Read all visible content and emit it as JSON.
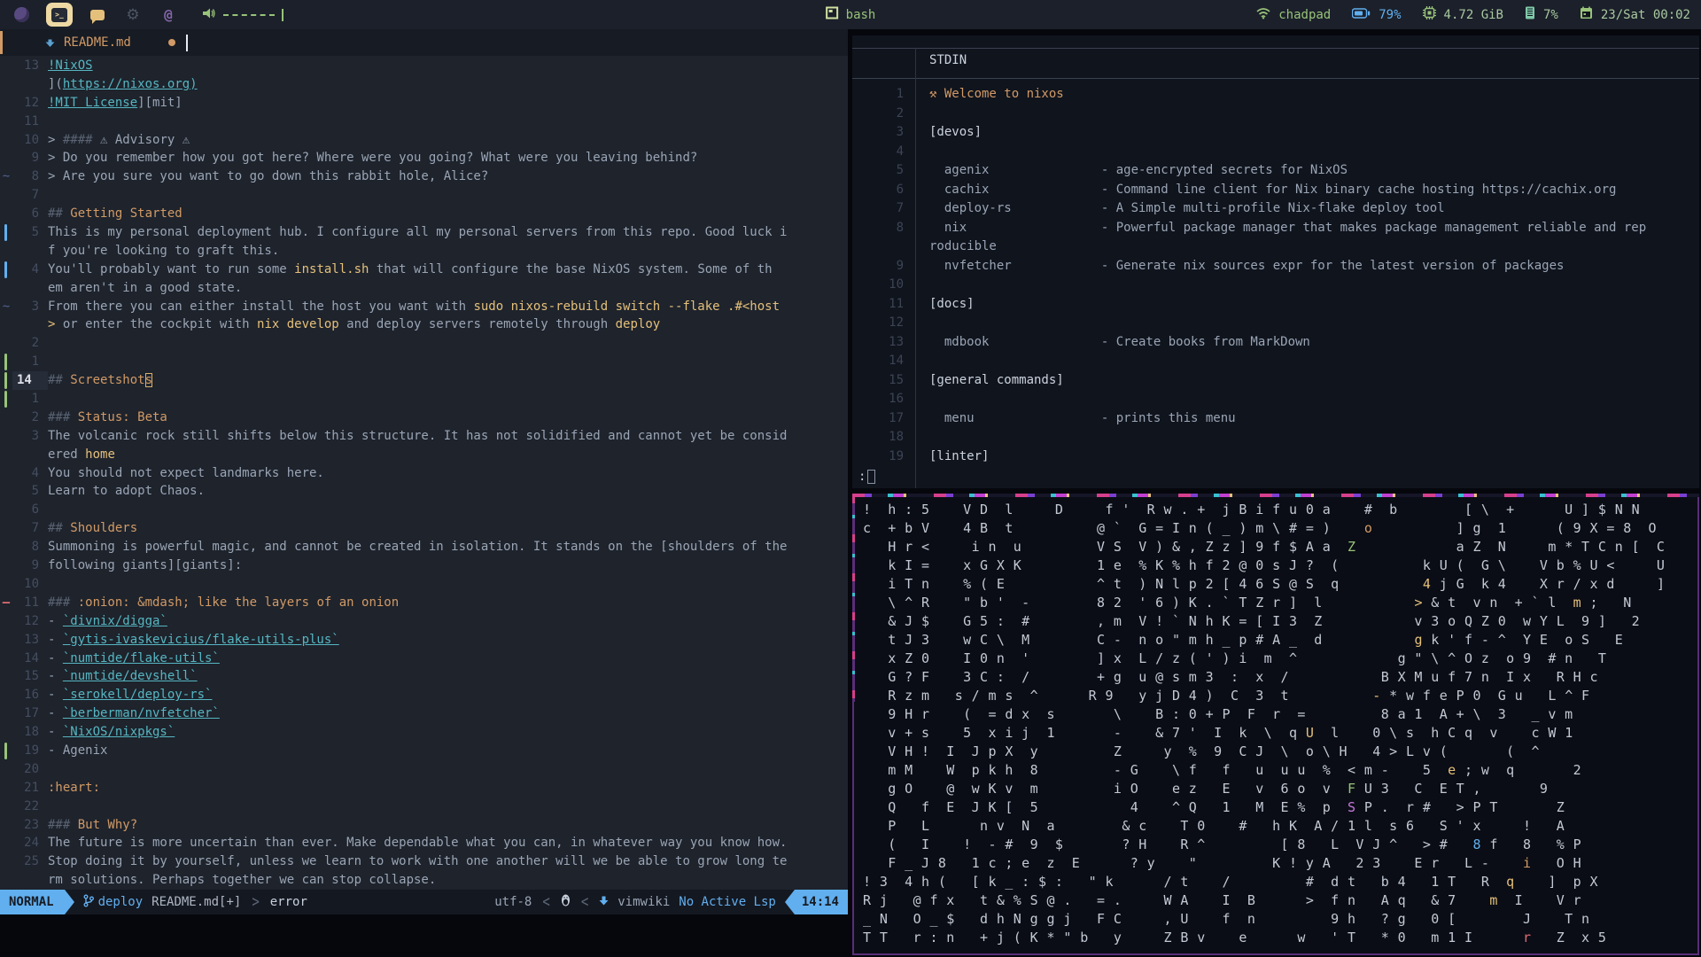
{
  "colors": {
    "accent_blue": "#61afef",
    "accent_orange": "#d19a66",
    "accent_yellow": "#e5c07b",
    "accent_green": "#98c379",
    "accent_cyan": "#56b6c2",
    "accent_red": "#e06c75",
    "topbar_bg": "#1b202a",
    "editor_bg": "#1e232c",
    "terminal_bg": "#10141d",
    "glitch_border": "#5a2e78"
  },
  "topbar": {
    "window_title": "bash",
    "hostname": "chadpad",
    "battery": "79%",
    "memory": "4.72 GiB",
    "cpu": "7%",
    "datetime": "23/Sat 00:02",
    "icons": [
      "browser-icon",
      "terminal-workspace-icon",
      "chat-icon",
      "gear-icon",
      "at-icon",
      "speaker-icon",
      "wifi-icon",
      "battery-icon",
      "cpu-icon",
      "ram-icon",
      "calendar-icon"
    ]
  },
  "editor": {
    "tab": {
      "filename": "README.md"
    },
    "rows": [
      {
        "n": "13",
        "sign": "",
        "segs": [
          [
            "link",
            "!NixOS"
          ]
        ]
      },
      {
        "n": "",
        "sign": "",
        "segs": [
          [
            "txt",
            "]("
          ],
          [
            "link",
            "https://nixos.org)"
          ]
        ]
      },
      {
        "n": "12",
        "sign": "",
        "segs": [
          [
            "link",
            "!MIT License"
          ],
          [
            "txt",
            "][mit]"
          ]
        ]
      },
      {
        "n": "11",
        "sign": "",
        "segs": []
      },
      {
        "n": "10",
        "sign": "",
        "segs": [
          [
            "txt",
            "> "
          ],
          [
            "mark",
            "#### "
          ],
          [
            "txt",
            "⚠ Advisory ⚠"
          ]
        ]
      },
      {
        "n": "9",
        "sign": "",
        "segs": [
          [
            "txt",
            "> Do you remember how you got here? Where were you going? What were you leaving behind?"
          ]
        ]
      },
      {
        "n": "8",
        "sign": "tilde",
        "segs": [
          [
            "txt",
            "> Are you sure you want to go down this rabbit hole, Alice?"
          ]
        ]
      },
      {
        "n": "7",
        "sign": "",
        "segs": []
      },
      {
        "n": "6",
        "sign": "",
        "segs": [
          [
            "mark",
            "## "
          ],
          [
            "hdr",
            "Getting Started"
          ]
        ]
      },
      {
        "n": "5",
        "sign": "bar-blue",
        "segs": [
          [
            "txt",
            "This is my personal deployment hub. I configure all my personal servers from this repo. Good luck i"
          ]
        ]
      },
      {
        "n": "",
        "sign": "",
        "segs": [
          [
            "txt",
            "f you're looking to graft this."
          ]
        ]
      },
      {
        "n": "4",
        "sign": "bar-blue",
        "segs": [
          [
            "txt",
            "You'll probably want to run some "
          ],
          [
            "code",
            "install.sh"
          ],
          [
            "txt",
            " that will configure the base NixOS system. Some of th"
          ]
        ]
      },
      {
        "n": "",
        "sign": "",
        "segs": [
          [
            "txt",
            "em aren't in a good state."
          ]
        ]
      },
      {
        "n": "3",
        "sign": "tilde",
        "segs": [
          [
            "txt",
            "From there you can either install the host you want with "
          ],
          [
            "code",
            "sudo nixos-rebuild switch --flake .#<host"
          ]
        ]
      },
      {
        "n": "",
        "sign": "",
        "segs": [
          [
            "code",
            "> "
          ],
          [
            "txt",
            "or enter the cockpit with "
          ],
          [
            "code",
            "nix develop"
          ],
          [
            "txt",
            " and deploy servers remotely through "
          ],
          [
            "code",
            "deploy"
          ]
        ]
      },
      {
        "n": "2",
        "sign": "",
        "segs": []
      },
      {
        "n": "1",
        "sign": "bar-green",
        "segs": []
      },
      {
        "n": "14",
        "sign": "bar-green",
        "cur": true,
        "segs": [
          [
            "mark",
            "## "
          ],
          [
            "hdr",
            "Screetshot"
          ],
          [
            "cur",
            "s"
          ]
        ]
      },
      {
        "n": "1",
        "sign": "bar-green",
        "segs": []
      },
      {
        "n": "2",
        "sign": "",
        "segs": [
          [
            "mark",
            "### "
          ],
          [
            "hdr",
            "Status: Beta"
          ]
        ]
      },
      {
        "n": "3",
        "sign": "",
        "segs": [
          [
            "txt",
            "The volcanic rock still shifts below this structure. It has not solidified and cannot yet be consid"
          ]
        ]
      },
      {
        "n": "",
        "sign": "",
        "segs": [
          [
            "txt",
            "ered "
          ],
          [
            "code",
            "home"
          ]
        ]
      },
      {
        "n": "4",
        "sign": "",
        "segs": [
          [
            "txt",
            "You should not expect landmarks here."
          ]
        ]
      },
      {
        "n": "5",
        "sign": "",
        "segs": [
          [
            "txt",
            "Learn to adopt Chaos."
          ]
        ]
      },
      {
        "n": "6",
        "sign": "",
        "segs": []
      },
      {
        "n": "7",
        "sign": "",
        "segs": [
          [
            "mark",
            "## "
          ],
          [
            "hdr",
            "Shoulders"
          ]
        ]
      },
      {
        "n": "8",
        "sign": "",
        "segs": [
          [
            "txt",
            "Summoning is powerful magic, and cannot be created in isolation. It stands on the [shoulders of the"
          ]
        ]
      },
      {
        "n": "9",
        "sign": "",
        "segs": [
          [
            "txt",
            "following giants][giants]:"
          ]
        ]
      },
      {
        "n": "10",
        "sign": "",
        "segs": []
      },
      {
        "n": "11",
        "sign": "dash-red",
        "segs": [
          [
            "mark",
            "### "
          ],
          [
            "hdr",
            ":onion: &mdash; like the layers of an onion"
          ]
        ]
      },
      {
        "n": "12",
        "sign": "",
        "segs": [
          [
            "txt",
            "- "
          ],
          [
            "link",
            "`divnix/digga`"
          ]
        ]
      },
      {
        "n": "13",
        "sign": "",
        "segs": [
          [
            "txt",
            "- "
          ],
          [
            "link",
            "`gytis-ivaskevicius/flake-utils-plus`"
          ]
        ]
      },
      {
        "n": "14",
        "sign": "",
        "segs": [
          [
            "txt",
            "- "
          ],
          [
            "link",
            "`numtide/flake-utils`"
          ]
        ]
      },
      {
        "n": "15",
        "sign": "",
        "segs": [
          [
            "txt",
            "- "
          ],
          [
            "link",
            "`numtide/devshell`"
          ]
        ]
      },
      {
        "n": "16",
        "sign": "",
        "segs": [
          [
            "txt",
            "- "
          ],
          [
            "link",
            "`serokell/deploy-rs`"
          ]
        ]
      },
      {
        "n": "17",
        "sign": "",
        "segs": [
          [
            "txt",
            "- "
          ],
          [
            "link",
            "`berberman/nvfetcher`"
          ]
        ]
      },
      {
        "n": "18",
        "sign": "",
        "segs": [
          [
            "txt",
            "- "
          ],
          [
            "link",
            "`NixOS/nixpkgs`"
          ]
        ]
      },
      {
        "n": "19",
        "sign": "bar-green",
        "segs": [
          [
            "txt",
            "- Agenix"
          ]
        ]
      },
      {
        "n": "20",
        "sign": "",
        "segs": []
      },
      {
        "n": "21",
        "sign": "",
        "segs": [
          [
            "hdr",
            ":heart:"
          ]
        ]
      },
      {
        "n": "22",
        "sign": "",
        "segs": []
      },
      {
        "n": "23",
        "sign": "",
        "segs": [
          [
            "mark",
            "### "
          ],
          [
            "hdr",
            "But Why?"
          ]
        ]
      },
      {
        "n": "24",
        "sign": "",
        "segs": [
          [
            "txt",
            "The future is more uncertain than ever. Make dependable what you can, in whatever way you know how."
          ]
        ]
      },
      {
        "n": "25",
        "sign": "",
        "segs": [
          [
            "txt",
            "Stop doing it by yourself, unless we learn to work with one another will we be able to grow long te"
          ]
        ]
      },
      {
        "n": "",
        "sign": "",
        "segs": [
          [
            "txt",
            "rm solutions. Perhaps together we can stop collapse."
          ]
        ]
      }
    ],
    "statusline": {
      "mode": "NORMAL",
      "branch": "deploy",
      "file": "README.md[+]",
      "diagnostic": "error",
      "encoding": "utf-8",
      "filetype": "vimwiki",
      "lsp": "No Active Lsp",
      "position": "14:14"
    }
  },
  "terminal": {
    "title": "STDIN",
    "prompt": ":",
    "lines": [
      {
        "n": "1",
        "segs": [
          [
            "ham",
            "⚒ "
          ],
          [
            "wel",
            "Welcome to nixos"
          ]
        ]
      },
      {
        "n": "2",
        "segs": []
      },
      {
        "n": "3",
        "segs": [
          [
            "bright",
            "[devos]"
          ]
        ]
      },
      {
        "n": "4",
        "segs": []
      },
      {
        "n": "5",
        "segs": [
          [
            "t",
            "  agenix               - age-encrypted secrets for NixOS"
          ]
        ]
      },
      {
        "n": "6",
        "segs": [
          [
            "t",
            "  cachix               - Command line client for Nix binary cache hosting https://cachix.org"
          ]
        ]
      },
      {
        "n": "7",
        "segs": [
          [
            "t",
            "  deploy-rs            - A Simple multi-profile Nix-flake deploy tool"
          ]
        ]
      },
      {
        "n": "8",
        "segs": [
          [
            "t",
            "  nix                  - Powerful package manager that makes package management reliable and rep"
          ]
        ]
      },
      {
        "n": "",
        "segs": [
          [
            "t",
            "roducible"
          ]
        ]
      },
      {
        "n": "9",
        "segs": [
          [
            "t",
            "  nvfetcher            - Generate nix sources expr for the latest version of packages"
          ]
        ]
      },
      {
        "n": "10",
        "segs": []
      },
      {
        "n": "11",
        "segs": [
          [
            "bright",
            "[docs]"
          ]
        ]
      },
      {
        "n": "12",
        "segs": []
      },
      {
        "n": "13",
        "segs": [
          [
            "t",
            "  mdbook               - Create books from MarkDown"
          ]
        ]
      },
      {
        "n": "14",
        "segs": []
      },
      {
        "n": "15",
        "segs": [
          [
            "bright",
            "[general commands]"
          ]
        ]
      },
      {
        "n": "16",
        "segs": []
      },
      {
        "n": "17",
        "segs": [
          [
            "t",
            "  menu                 - prints this menu"
          ]
        ]
      },
      {
        "n": "18",
        "segs": []
      },
      {
        "n": "19",
        "segs": [
          [
            "bright",
            "[linter]"
          ]
        ]
      }
    ]
  },
  "glitch": {
    "rows": [
      "!  h : 5    V D  l     D     f '  R w . +  j B i f u 0 a    #  b        [ \\  +      U ] $ N N",
      "c  + b V    4 B  t          @ `  G = I n ( _ ) m \\ # = )    o          ] g  1      ( 9 X = 8  O",
      "   H r <     i n  u         V S  V ) & , Z z ] 9 f $ A a  Z            a Z  N     m * T C n [  C",
      "   k I =    x G X K         1 e  % K % h f 2 @ 0 s J ?  (          k U (  G \\    V b % U <     U",
      "   i T n    % ( E           ^ t  ) N l p 2 [ 4 6 S @ S  q          4 j G  k 4    X r / x d     ]",
      "   \\ ^ R    \" b '  -        8 2  ' 6 ) K . ` T Z r ]  l           > & t  v n  + ` l  m ;   N",
      "   & J $    G 5 :  #        , m  V ! ` N h K = [ I 3  Z           v 3 o Q Z 0  w Y L  9 ]   2",
      "   t J 3    w C \\  M        C -  n o \" m h _ p # A _  d           g k ' f - ^  Y E  o S   E",
      "   x Z 0    I 0 n  '        ] x  L / z ( ' ) i  m  ^            g \" \\ ^ O z  o 9  # n   T",
      "   G ? F    3 C :  /        + g  u @ s m 3  :  x  /           B X M u f 7 n  I x   R H c",
      "   R z m   s / m s  ^      R 9   y j D 4 )  C  3  t          - * w f e P 0  G u   L ^ F",
      "   9 H r    (  = d x  s       \\    B : 0 + P  F  r  =         8 a 1  A + \\  3   _ v m",
      "   v + s    5  x i j  1       -    & 7 '  I  k  \\  q U  l    0 \\ s  h C q  v    c W 1",
      "   V H !  I  J p X  y         Z     y  %  9  C J  \\  o \\ H   4 > L v (       (  ^",
      "   m M    W  p k h  8         - G    \\ f   f   u  u u  %  < m -    5  e ; w  q       2",
      "   g O    @  w K v  m         i O    e z   E   v  6 o  v  F U 3   C  E T ,       9",
      "   Q   f  E  J K [  5           4    ^ Q   1   M  E %  p  S P .  r #   > P T       Z",
      "   P   L      n v  N  a        & c    T 0    #   h K  A / 1 l  s 6   S ' x     !   A",
      "   (   I    !  - #  9  $       ? H    R ^         [ 8   L  V J ^   > #   8 f   8   % P",
      "   F _ J 8   1 c ; e  z  E      ? y    \"         K ! y A   2 3    E r   L -    i   O H",
      "! 3  4 h (   [ k _ : $ :   \" k      / t    /         #  d t   b 4   1 T   R  q    ]  p X",
      "R j   @ f x   t & % S @ .   = .     W A    I  B      >  f n   A q   & 7    m  I    V r",
      "_ N   O _ $   d h N g g j   F C     , U    f  n         9 h   ? g   0 [        J    T n",
      "T T   r : n   + j ( K * \" b   y     Z B v    e      w   ' T   * 0   m 1 I      r   Z  x 5"
    ],
    "highlights": [
      [
        2,
        57,
        "#d19a66"
      ],
      [
        3,
        58,
        "#98c379"
      ],
      [
        5,
        57,
        "#e5c07b"
      ],
      [
        6,
        55,
        "#e5c07b"
      ],
      [
        6,
        84,
        "#e5c07b"
      ],
      [
        8,
        55,
        "#e5c07b"
      ],
      [
        11,
        53,
        "#e5c07b"
      ],
      [
        13,
        53,
        "#e5c07b"
      ],
      [
        15,
        69,
        "#e5c07b"
      ],
      [
        16,
        57,
        "#98c379"
      ],
      [
        17,
        57,
        "#c678dd"
      ],
      [
        19,
        72,
        "#61afef"
      ],
      [
        20,
        79,
        "#d19a66"
      ],
      [
        21,
        76,
        "#e5c07b"
      ],
      [
        22,
        71,
        "#e5c07b"
      ],
      [
        24,
        73,
        "#e06c75"
      ]
    ]
  }
}
